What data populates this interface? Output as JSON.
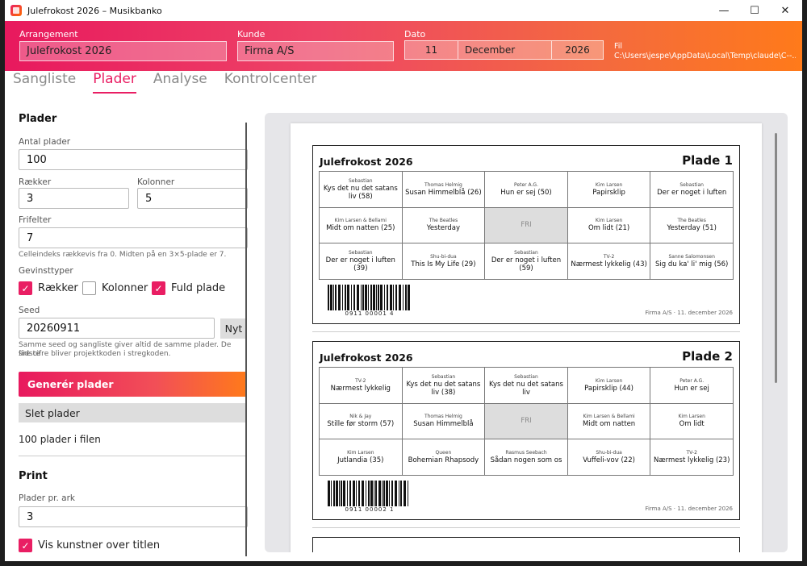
{
  "window": {
    "title": "Julefrokost 2026 – Musikbanko",
    "minimize": "—",
    "maximize": "☐",
    "close": "✕"
  },
  "header": {
    "arrangement_label": "Arrangement",
    "arrangement_value": "Julefrokost 2026",
    "kunde_label": "Kunde",
    "kunde_value": "Firma A/S",
    "dato_label": "Dato",
    "day": "11",
    "month": "December",
    "year": "2026",
    "fil_label": "Fil",
    "fil_path": "C:\\Users\\jespe\\AppData\\Local\\Temp\\claude\\C--..."
  },
  "tabs": [
    {
      "label": "Sangliste"
    },
    {
      "label": "Plader"
    },
    {
      "label": "Analyse"
    },
    {
      "label": "Kontrolcenter"
    }
  ],
  "plader": {
    "section": "Plader",
    "antal_label": "Antal plader",
    "antal_value": "100",
    "raekker_label": "Rækker",
    "raekker_value": "3",
    "kolonner_label": "Kolonner",
    "kolonner_value": "5",
    "frifelter_label": "Frifelter",
    "frifelter_value": "7",
    "frifelter_hint": "Celleindeks rækkevis fra 0. Midten på en 3×5-plade er 7.",
    "gevinst_label": "Gevinsttyper",
    "cb_raekker": "Rækker",
    "cb_kolonner": "Kolonner",
    "cb_fuld": "Fuld plade",
    "seed_label": "Seed",
    "seed_value": "20260911",
    "nyt_label": "Nyt",
    "seed_hint_1": "Samme seed og sangliste giver altid de samme plader. De sidste",
    "seed_hint_2": "fire cifre bliver projektkoden i stregkoden.",
    "generate_label": "Generér plader",
    "delete_label": "Slet plader",
    "count_text": "100 plader i filen"
  },
  "print": {
    "section": "Print",
    "per_ark_label": "Plader pr. ark",
    "per_ark_value": "3",
    "vis_kunstner": "Vis kunstner over titlen"
  },
  "preview": {
    "cards": [
      {
        "title": "Julefrokost 2026",
        "plate": "Plade 1",
        "barcode": "0911 00001 4",
        "footer": "Firma A/S · 11. december 2026",
        "cells": [
          {
            "artist": "Sebastian",
            "song": "Kys det nu det satans liv (58)"
          },
          {
            "artist": "Thomas Helmig",
            "song": "Susan Himmelblå (26)"
          },
          {
            "artist": "Peter A.G.",
            "song": "Hun er sej (50)"
          },
          {
            "artist": "Kim Larsen",
            "song": "Papirsklip"
          },
          {
            "artist": "Sebastian",
            "song": "Der er noget i luften"
          },
          {
            "artist": "Kim Larsen & Bellami",
            "song": "Midt om natten (25)"
          },
          {
            "artist": "The Beatles",
            "song": "Yesterday"
          },
          {
            "artist": "",
            "song": "FRI",
            "free": true
          },
          {
            "artist": "Kim Larsen",
            "song": "Om lidt (21)"
          },
          {
            "artist": "The Beatles",
            "song": "Yesterday (51)"
          },
          {
            "artist": "Sebastian",
            "song": "Der er noget i luften (39)"
          },
          {
            "artist": "Shu-bi-dua",
            "song": "This Is My Life (29)"
          },
          {
            "artist": "Sebastian",
            "song": "Der er noget i luften (59)"
          },
          {
            "artist": "TV-2",
            "song": "Nærmest lykkelig (43)"
          },
          {
            "artist": "Sanne Salomonsen",
            "song": "Sig du ka' li' mig (56)"
          }
        ]
      },
      {
        "title": "Julefrokost 2026",
        "plate": "Plade 2",
        "barcode": "0911 00002 1",
        "footer": "Firma A/S · 11. december 2026",
        "cells": [
          {
            "artist": "TV-2",
            "song": "Nærmest lykkelig"
          },
          {
            "artist": "Sebastian",
            "song": "Kys det nu det satans liv (38)"
          },
          {
            "artist": "Sebastian",
            "song": "Kys det nu det satans liv"
          },
          {
            "artist": "Kim Larsen",
            "song": "Papirsklip (44)"
          },
          {
            "artist": "Peter A.G.",
            "song": "Hun er sej"
          },
          {
            "artist": "Nik & Jay",
            "song": "Stille før storm (57)"
          },
          {
            "artist": "Thomas Helmig",
            "song": "Susan Himmelblå"
          },
          {
            "artist": "",
            "song": "FRI",
            "free": true
          },
          {
            "artist": "Kim Larsen & Bellami",
            "song": "Midt om natten"
          },
          {
            "artist": "Kim Larsen",
            "song": "Om lidt"
          },
          {
            "artist": "Kim Larsen",
            "song": "Jutlandia (35)"
          },
          {
            "artist": "Queen",
            "song": "Bohemian Rhapsody"
          },
          {
            "artist": "Rasmus Seebach",
            "song": "Sådan nogen som os"
          },
          {
            "artist": "Shu-bi-dua",
            "song": "Vuffeli-vov (22)"
          },
          {
            "artist": "TV-2",
            "song": "Nærmest lykkelig (23)"
          }
        ]
      }
    ]
  },
  "colors": {
    "accent": "#e91e63",
    "accent2": "#ff7a1a"
  }
}
